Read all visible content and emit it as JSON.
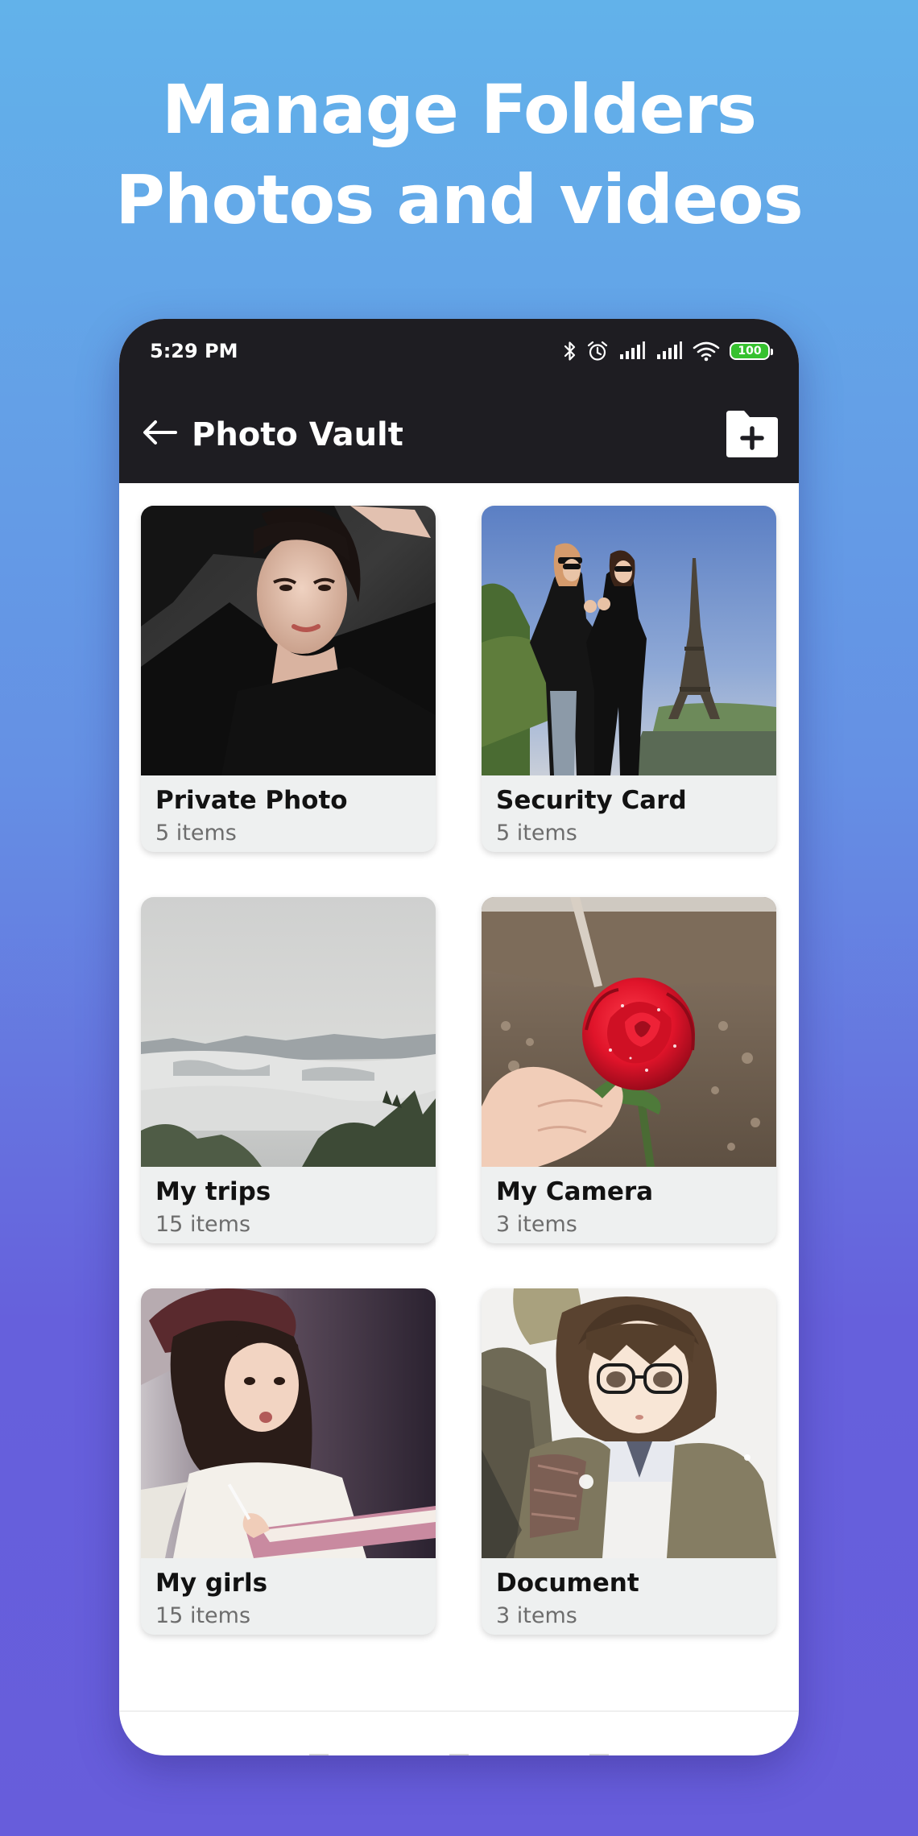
{
  "headline": {
    "line1": "Manage Folders",
    "line2": "Photos and videos"
  },
  "status_bar": {
    "time": "5:29 PM",
    "battery": "100",
    "icons": [
      "bluetooth-icon",
      "alarm-icon",
      "signal-icon",
      "signal-icon",
      "wifi-icon",
      "battery-icon"
    ]
  },
  "app_bar": {
    "title": "Photo Vault",
    "back_icon": "arrow-left-icon",
    "action_icon": "folder-plus-icon"
  },
  "folders": [
    {
      "name": "Private Photo",
      "count": "5 items",
      "thumbnail": "portrait-dark"
    },
    {
      "name": "Security Card",
      "count": "5 items",
      "thumbnail": "eiffel-tower"
    },
    {
      "name": "My trips",
      "count": "15 items",
      "thumbnail": "foggy-mountains"
    },
    {
      "name": "My Camera",
      "count": "3 items",
      "thumbnail": "red-rose"
    },
    {
      "name": "My girls",
      "count": "15 items",
      "thumbnail": "girl-with-book"
    },
    {
      "name": "Document",
      "count": "3 items",
      "thumbnail": "anime-character"
    }
  ],
  "colors": {
    "bar_background": "#1e1d22",
    "card_background": "#eef0f0",
    "battery_green": "#36c12f",
    "gradient_top": "#62b2ea",
    "gradient_bottom": "#675ddb"
  }
}
